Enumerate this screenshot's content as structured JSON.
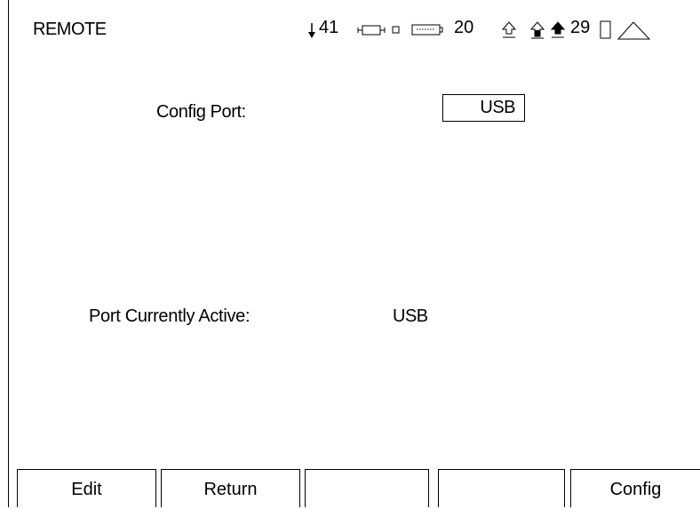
{
  "header": {
    "title": "REMOTE",
    "status": {
      "value1": "41",
      "value2": "20",
      "value3": "29"
    }
  },
  "main": {
    "config_port_label": "Config Port:",
    "config_port_value": "USB",
    "port_active_label": "Port Currently Active:",
    "port_active_value": "USB"
  },
  "softkeys": [
    {
      "label": "Edit"
    },
    {
      "label": "Return"
    },
    {
      "label": ""
    },
    {
      "label": ""
    },
    {
      "label": "Config"
    }
  ]
}
